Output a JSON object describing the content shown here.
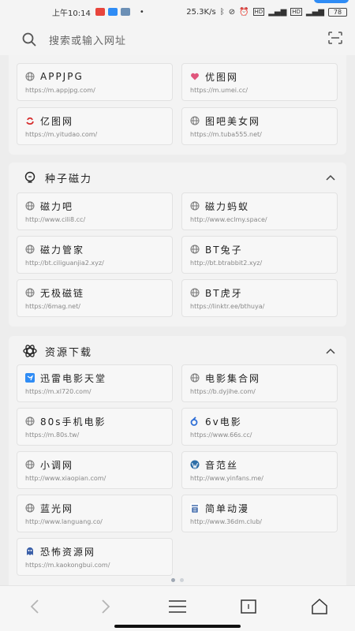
{
  "status_bar": {
    "time": "上午10:14",
    "speed": "25.3K/s",
    "network_badge_1": "HD",
    "network_badge_2": "HD",
    "battery": "78",
    "colors": {
      "badge_red": "#e8453c",
      "badge_blue": "#2f8cf5"
    }
  },
  "search": {
    "placeholder": "搜索或输入网址"
  },
  "sections": [
    {
      "title": "",
      "items": [
        {
          "name": "APPJPG",
          "url": "https://m.appjpg.com/",
          "icon": "globe-icon"
        },
        {
          "name": "优图网",
          "url": "https://m.umei.cc/",
          "icon": "pink-heart-icon"
        },
        {
          "name": "亿图网",
          "url": "https://m.yitudao.com/",
          "icon": "red-swirl-icon"
        },
        {
          "name": "图吧美女网",
          "url": "https://m.tuba555.net/",
          "icon": "globe-icon"
        }
      ]
    },
    {
      "title": "种子磁力",
      "icon": "bulb-icon",
      "items": [
        {
          "name": "磁力吧",
          "url": "http://www.cili8.cc/",
          "icon": "globe-icon"
        },
        {
          "name": "磁力蚂蚁",
          "url": "http://www.eclmy.space/",
          "icon": "globe-icon"
        },
        {
          "name": "磁力管家",
          "url": "http://bt.ciliguanjia2.xyz/",
          "icon": "globe-icon"
        },
        {
          "name": "BT兔子",
          "url": "http://bt.btrabbit2.xyz/",
          "icon": "globe-icon"
        },
        {
          "name": "无极磁链",
          "url": "https://6mag.net/",
          "icon": "globe-icon"
        },
        {
          "name": "BT虎牙",
          "url": "https://linktr.ee/bthuya/",
          "icon": "globe-icon"
        }
      ]
    },
    {
      "title": "资源下载",
      "icon": "atom-icon",
      "items": [
        {
          "name": "迅雷电影天堂",
          "url": "https://m.xl720.com/",
          "icon": "thunder-icon"
        },
        {
          "name": "电影集合网",
          "url": "https://b.dyjihe.com/",
          "icon": "globe-icon"
        },
        {
          "name": "80s手机电影",
          "url": "https://m.80s.tw/",
          "icon": "globe-icon"
        },
        {
          "name": "6v电影",
          "url": "https://www.66s.cc/",
          "icon": "six-v-icon"
        },
        {
          "name": "小调网",
          "url": "http://www.xiaopian.com/",
          "icon": "globe-icon"
        },
        {
          "name": "音范丝",
          "url": "http://www.yinfans.me/",
          "icon": "wordpress-icon"
        },
        {
          "name": "蓝光网",
          "url": "http://www.languang.co/",
          "icon": "globe-icon"
        },
        {
          "name": "简单动漫",
          "url": "http://www.36dm.club/",
          "icon": "jian-icon"
        },
        {
          "name": "恐怖资源网",
          "url": "https://m.kaokongbui.com/",
          "icon": "ghost-icon"
        }
      ]
    }
  ]
}
